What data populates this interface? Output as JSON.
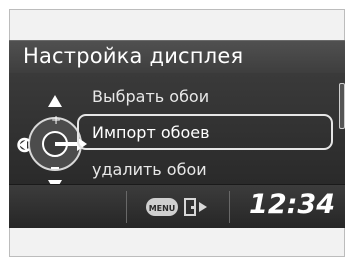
{
  "screen": {
    "title": "Настройка дисплея",
    "menu_items": [
      {
        "label": "Выбрать обои",
        "selected": false
      },
      {
        "label": "Импорт обоев",
        "selected": true
      },
      {
        "label": "удалить обои",
        "selected": false
      }
    ],
    "menu_button_label": "MENU",
    "clock": "12:34"
  },
  "icons": {
    "knob": "interface-dial-icon",
    "up": "arrow-up-icon",
    "down": "arrow-down-icon",
    "back": "back-arrow-icon",
    "menu": "menu-button-icon",
    "exit": "exit-door-icon"
  },
  "colors": {
    "screen_bg": "#3a3a3a",
    "text": "#ffffff",
    "highlight_border": "#e6e6e6"
  }
}
